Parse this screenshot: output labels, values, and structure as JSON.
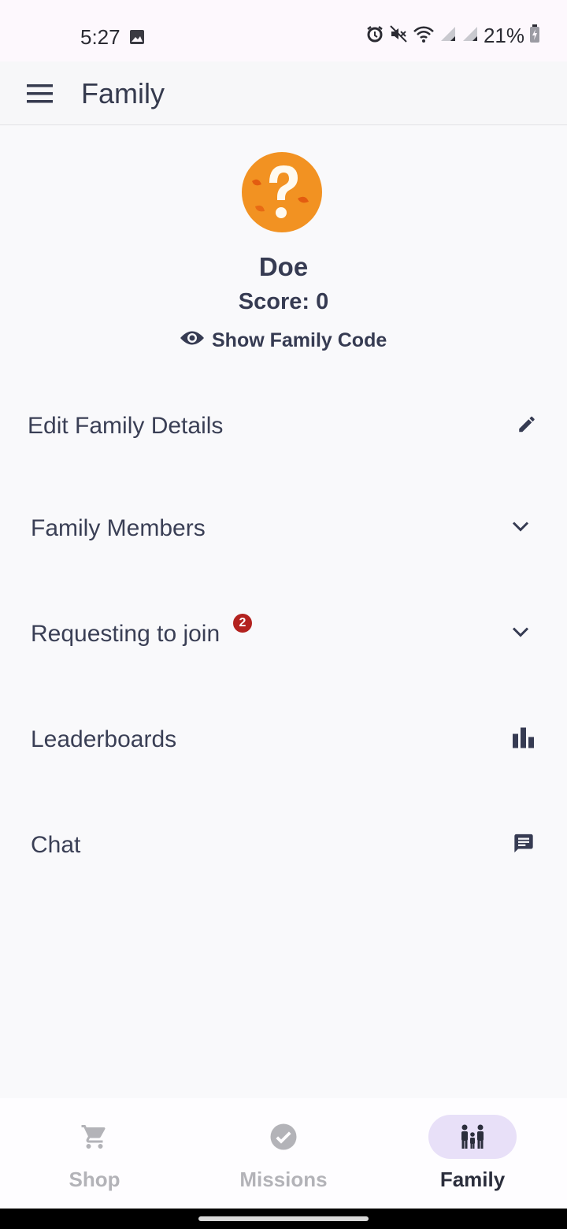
{
  "status_bar": {
    "time": "5:27",
    "battery": "21%",
    "icons": [
      "image-icon",
      "alarm-icon",
      "mute-icon",
      "wifi-icon",
      "signal-icon",
      "signal-icon",
      "battery-charging-icon"
    ]
  },
  "app_bar": {
    "title": "Family",
    "menu_icon": "menu-icon"
  },
  "profile": {
    "avatar_icon": "question-mark-avatar-icon",
    "name": "Doe",
    "score": "Score: 0",
    "show_code_label": "Show Family Code",
    "show_code_icon": "eye-icon"
  },
  "rows": [
    {
      "label": "Edit Family Details",
      "icon": "edit-icon"
    },
    {
      "label": "Family Members",
      "icon": "chevron-down-icon"
    },
    {
      "label": "Requesting to join",
      "icon": "chevron-down-icon",
      "badge": "2"
    },
    {
      "label": "Leaderboards",
      "icon": "bar-chart-icon"
    },
    {
      "label": "Chat",
      "icon": "chat-icon"
    }
  ],
  "bottom_nav": {
    "items": [
      {
        "label": "Shop",
        "icon": "cart-icon",
        "active": false
      },
      {
        "label": "Missions",
        "icon": "check-circle-icon",
        "active": false
      },
      {
        "label": "Family",
        "icon": "family-icon",
        "active": true
      }
    ]
  },
  "colors": {
    "primary_text": "#363b52",
    "badge": "#b3221f",
    "active_pill": "#e8e0f8",
    "inactive_nav": "#b3b3b8",
    "avatar_orange": "#f0901e"
  }
}
